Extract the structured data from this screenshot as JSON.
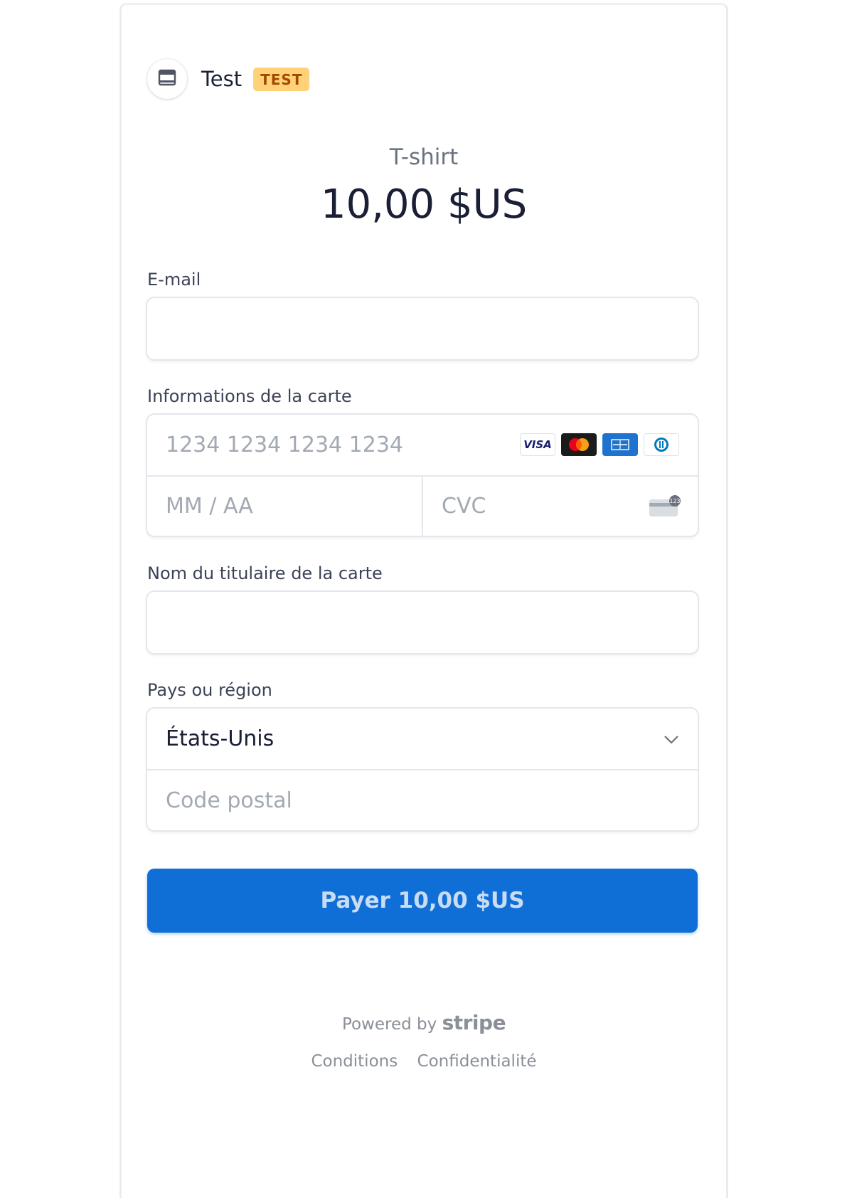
{
  "merchant": {
    "name": "Test",
    "badge": "TEST",
    "icon": "store-icon"
  },
  "product": {
    "name": "T-shirt",
    "price": "10,00 $US"
  },
  "form": {
    "email": {
      "label": "E-mail",
      "value": "",
      "placeholder": ""
    },
    "card": {
      "label": "Informations de la carte",
      "number_placeholder": "1234 1234 1234 1234",
      "expiry_placeholder": "MM / AA",
      "cvc_placeholder": "CVC",
      "brand_icons": [
        "visa-icon",
        "mastercard-icon",
        "amex-icon",
        "diners-icon"
      ],
      "visa_text": "VISA",
      "cvc_icon": "card-cvc-icon"
    },
    "cardholder": {
      "label": "Nom du titulaire de la carte",
      "value": "",
      "placeholder": ""
    },
    "country": {
      "label": "Pays ou région",
      "selected": "États-Unis",
      "postal_placeholder": "Code postal",
      "icon": "chevron-down-icon"
    }
  },
  "pay_button": {
    "label": "Payer 10,00 $US",
    "color": "#0f6fd6"
  },
  "footer": {
    "powered_by": "Powered by",
    "stripe": "stripe",
    "terms": "Conditions",
    "privacy": "Confidentialité"
  },
  "colors": {
    "badge_bg": "#ffd27a",
    "badge_text": "#a04a00",
    "accent": "#0f6fd6"
  }
}
